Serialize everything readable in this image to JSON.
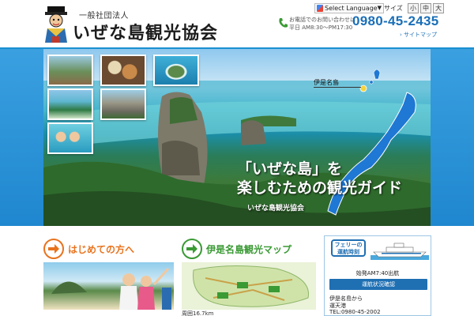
{
  "header": {
    "org_small": "一般社団法人",
    "org_name": "いぜな島観光協会",
    "language_select": "Select Language",
    "size_label": "サイズ",
    "size_buttons": [
      "小",
      "中",
      "大"
    ],
    "contact_label_1": "お電話でのお問い合わせは",
    "contact_label_2": "平日 AM8:30〜PM17:30",
    "phone": "0980-45-2435",
    "sitemap": "› サイトマップ"
  },
  "hero": {
    "catch_line_1": "「いぜな島」を",
    "catch_line_2": "楽しむための観光ガイド",
    "catch_org": "いぜな島観光協会",
    "map_label": "伊是名島"
  },
  "cards": [
    {
      "title": "はじめての方へ",
      "color": "#e8731e",
      "desc": ""
    },
    {
      "title": "伊是名島観光マップ",
      "color": "#3a9a34",
      "desc": "周囲16.7km"
    }
  ],
  "ferry": {
    "badge_line_1": "フェリーの",
    "badge_line_2": "運航時刻",
    "first_departure": "始発AM7:40出航",
    "button": "運航状況確認",
    "line_1": "伊是名島から",
    "line_2": "運天港",
    "line_3": "TEL:0980-45-2002"
  },
  "colors": {
    "accent_blue": "#1a8fd1",
    "phone_blue": "#1a6fb8",
    "ferry_blue": "#1f6fb3",
    "orange": "#e8731e",
    "green": "#3a9a34"
  }
}
